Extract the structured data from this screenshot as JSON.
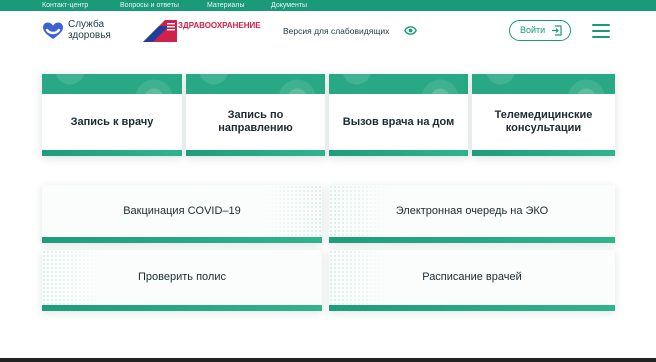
{
  "topbar": {
    "links": [
      {
        "label": "Контакт-центр"
      },
      {
        "label": "Вопросы и ответы"
      },
      {
        "label": "Материалы"
      },
      {
        "label": "Документы"
      }
    ]
  },
  "header": {
    "logo_line1": "Служба",
    "logo_line2": "здоровья",
    "national_project": "ЗДРАВООХРАНЕНИЕ",
    "accessibility_label": "Версия для слабовидящих",
    "login_label": "Войти"
  },
  "services": [
    {
      "title": "Запись к врачу"
    },
    {
      "title": "Запись по направлению"
    },
    {
      "title": "Вызов врача на дом"
    },
    {
      "title": "Телемедицинские консультации"
    }
  ],
  "tiles": [
    {
      "title": "Вакцинация COVID–19"
    },
    {
      "title": "Электронная очередь на ЭКО"
    },
    {
      "title": "Проверить полис"
    },
    {
      "title": "Расписание врачей"
    }
  ],
  "colors": {
    "accent": "#1a9a78",
    "band": "#28a884",
    "brand_red": "#d1214a",
    "logo_blue": "#3b63d6",
    "text_dark": "#1b2b33"
  },
  "icons": {
    "logo": "heart-logo-icon",
    "a11y": "eye-icon",
    "login": "login-icon",
    "menu": "hamburger-menu-icon"
  }
}
